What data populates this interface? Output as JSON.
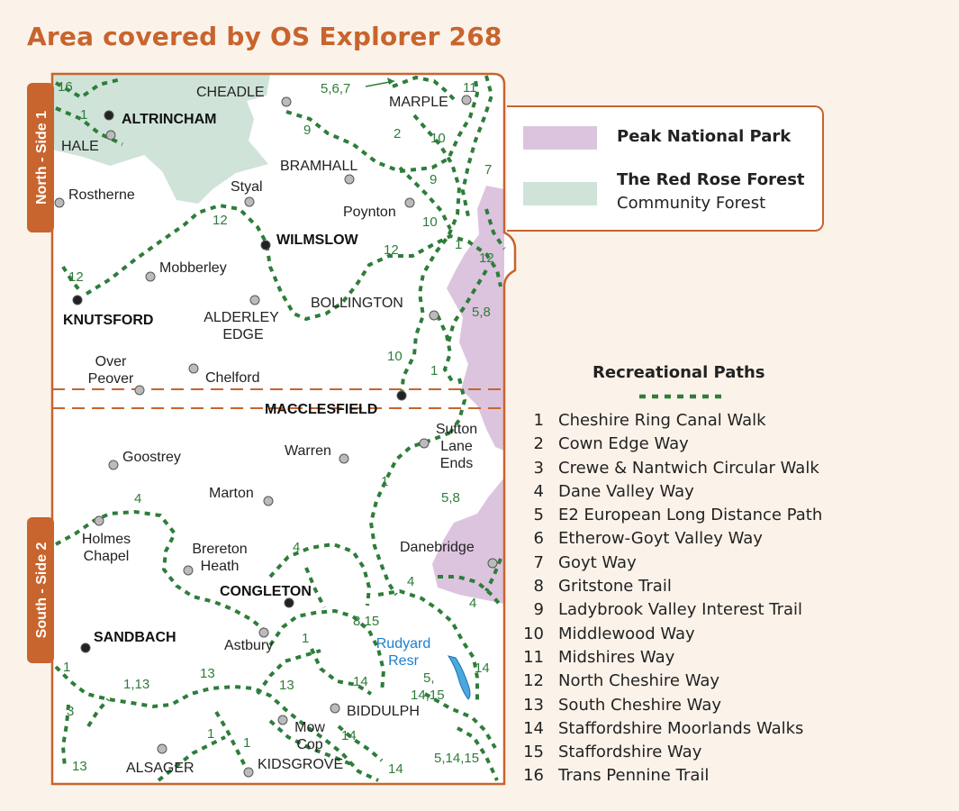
{
  "title": "Area covered by OS Explorer 268",
  "colors": {
    "accent": "#c8642d",
    "peak_park": "#dcc4df",
    "red_rose": "#cfe3d8",
    "path_green": "#2e7d3a"
  },
  "side_labels": {
    "north": "North - Side 1",
    "south": "South - Side 2"
  },
  "legend": {
    "peak": "Peak National Park",
    "forest_title": "The Red Rose Forest",
    "forest_sub": "Community Forest"
  },
  "paths": {
    "title": "Recreational Paths",
    "items": [
      {
        "num": "1",
        "name": "Cheshire Ring Canal Walk"
      },
      {
        "num": "2",
        "name": "Cown Edge Way"
      },
      {
        "num": "3",
        "name": "Crewe & Nantwich Circular Walk"
      },
      {
        "num": "4",
        "name": "Dane Valley Way"
      },
      {
        "num": "5",
        "name": "E2 European Long Distance Path"
      },
      {
        "num": "6",
        "name": "Etherow-Goyt Valley Way"
      },
      {
        "num": "7",
        "name": "Goyt Way"
      },
      {
        "num": "8",
        "name": "Gritstone Trail"
      },
      {
        "num": "9",
        "name": "Ladybrook Valley Interest Trail"
      },
      {
        "num": "10",
        "name": "Middlewood Way"
      },
      {
        "num": "11",
        "name": "Midshires Way"
      },
      {
        "num": "12",
        "name": "North Cheshire Way"
      },
      {
        "num": "13",
        "name": "South Cheshire Way"
      },
      {
        "num": "14",
        "name": "Staffordshire Moorlands Walks"
      },
      {
        "num": "15",
        "name": "Staffordshire Way"
      },
      {
        "num": "16",
        "name": "Trans Pennine Trail"
      }
    ]
  },
  "places": {
    "cheadle": "CHEADLE",
    "marple": "MARPLE",
    "altrincham": "ALTRINCHAM",
    "hale": "HALE",
    "bramhall": "BRAMHALL",
    "rostherne": "Rostherne",
    "styal": "Styal",
    "poynton": "Poynton",
    "wilmslow": "WILMSLOW",
    "mobberley": "Mobberley",
    "knutsford": "KNUTSFORD",
    "alderley1": "ALDERLEY",
    "alderley2": "EDGE",
    "bollington": "BOLLINGTON",
    "over1": "Over",
    "over2": "Peover",
    "chelford": "Chelford",
    "macclesfield": "MACCLESFIELD",
    "sutton1": "Sutton",
    "sutton2": "Lane",
    "sutton3": "Ends",
    "goostrey": "Goostrey",
    "warren": "Warren",
    "marton": "Marton",
    "holmes1": "Holmes",
    "holmes2": "Chapel",
    "brereton1": "Brereton",
    "brereton2": "Heath",
    "danebridge": "Danebridge",
    "congleton": "CONGLETON",
    "sandbach": "SANDBACH",
    "astbury": "Astbury",
    "rudyard1": "Rudyard",
    "rudyard2": "Resr",
    "biddulph": "BIDDULPH",
    "mow1": "Mow",
    "mow2": "Cop",
    "alsager": "ALSAGER",
    "kidsgrove": "KIDSGROVE"
  },
  "path_labels": {
    "p16": "16",
    "p1a": "1",
    "p567": "5,6,7",
    "p11": "11",
    "p9a": "9",
    "p2": "2",
    "p10a": "10",
    "p7": "7",
    "p9b": "9",
    "p12a": "12",
    "p10b": "10",
    "p12b": "12",
    "p1b": "1",
    "p12c": "12",
    "p12d": "12",
    "p58a": "5,8",
    "p10c": "10",
    "p1c": "1",
    "p1d": "1",
    "p58b": "5,8",
    "p4a": "4",
    "p4b": "4",
    "p4c": "4",
    "p4d": "4",
    "p815": "8,15",
    "p1e": "1",
    "p14a": "14",
    "p514_15": "5,",
    "p1415": "14,15",
    "p14b": "14",
    "p1f": "1",
    "p113": "1,13",
    "p13a": "13",
    "p13b": "13",
    "p3": "3",
    "p13c": "13",
    "p1g": "1",
    "p1h": "1",
    "p14c": "14",
    "p14d": "14",
    "p51415": "5,14,15"
  }
}
